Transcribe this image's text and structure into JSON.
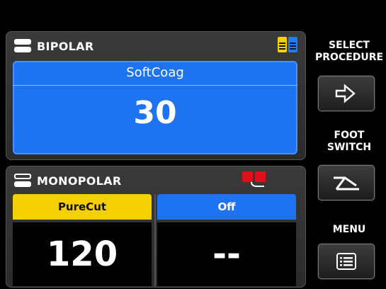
{
  "bipolar": {
    "title": "BIPOLAR",
    "mode": "SoftCoag",
    "value": "30"
  },
  "monopolar": {
    "title": "MONOPOLAR",
    "cut": {
      "mode": "PureCut",
      "value": "120"
    },
    "coag": {
      "mode": "Off",
      "value": "--"
    }
  },
  "side": {
    "select_procedure_l1": "SELECT",
    "select_procedure_l2": "PROCEDURE",
    "foot_switch_l1": "FOOT",
    "foot_switch_l2": "SWITCH",
    "menu": "MENU"
  },
  "icons": {
    "bipolar": "bipolar-plug-icon",
    "bipolar_pedal": "dual-pedal-icon",
    "monopolar": "monopolar-plug-icon",
    "monopolar_pedal": "red-pedal-icon",
    "select_procedure": "enter-arrow-icon",
    "foot_switch": "foot-pedal-icon",
    "menu": "list-icon"
  },
  "colors": {
    "bipolar_display": "#1e73f0",
    "cut_yellow": "#f5d000",
    "coag_blue": "#1e73f0",
    "pedal_red": "#e0101a"
  }
}
